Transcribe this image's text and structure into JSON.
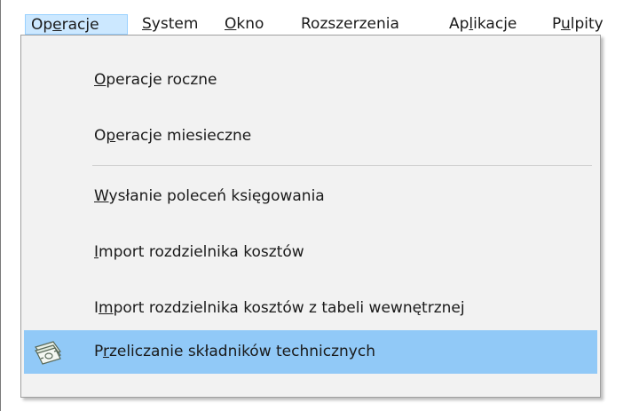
{
  "menubar": {
    "items": [
      {
        "pre": "Op",
        "ul": "e",
        "post": "racje"
      },
      {
        "pre": "",
        "ul": "S",
        "post": "ystem"
      },
      {
        "pre": "",
        "ul": "O",
        "post": "kno"
      },
      {
        "pre": "Rozszerzenia",
        "ul": "",
        "post": ""
      },
      {
        "pre": "Ap",
        "ul": "l",
        "post": "ikacje"
      },
      {
        "pre": "P",
        "ul": "u",
        "post": "lpity"
      }
    ]
  },
  "dropdown": {
    "items": [
      {
        "pre": "",
        "ul": "O",
        "post": "peracje roczne",
        "icon": ""
      },
      {
        "pre": "O",
        "ul": "p",
        "post": "eracje miesieczne",
        "icon": ""
      },
      {
        "pre": "",
        "ul": "W",
        "post": "ysłanie poleceń księgowania",
        "icon": ""
      },
      {
        "pre": "",
        "ul": "I",
        "post": "mport rozdzielnika kosztów",
        "icon": ""
      },
      {
        "pre": "I",
        "ul": "m",
        "post": "port rozdzielnika kosztów z tabeli wewnętrznej",
        "icon": ""
      },
      {
        "pre": "P",
        "ul": "r",
        "post": "zeliczanie składników technicznych",
        "icon": "money-stack-icon"
      }
    ]
  },
  "colors": {
    "highlight": "#91c9f7",
    "menubar_active": "#cce8ff",
    "dropdown_bg": "#f2f2f2"
  }
}
